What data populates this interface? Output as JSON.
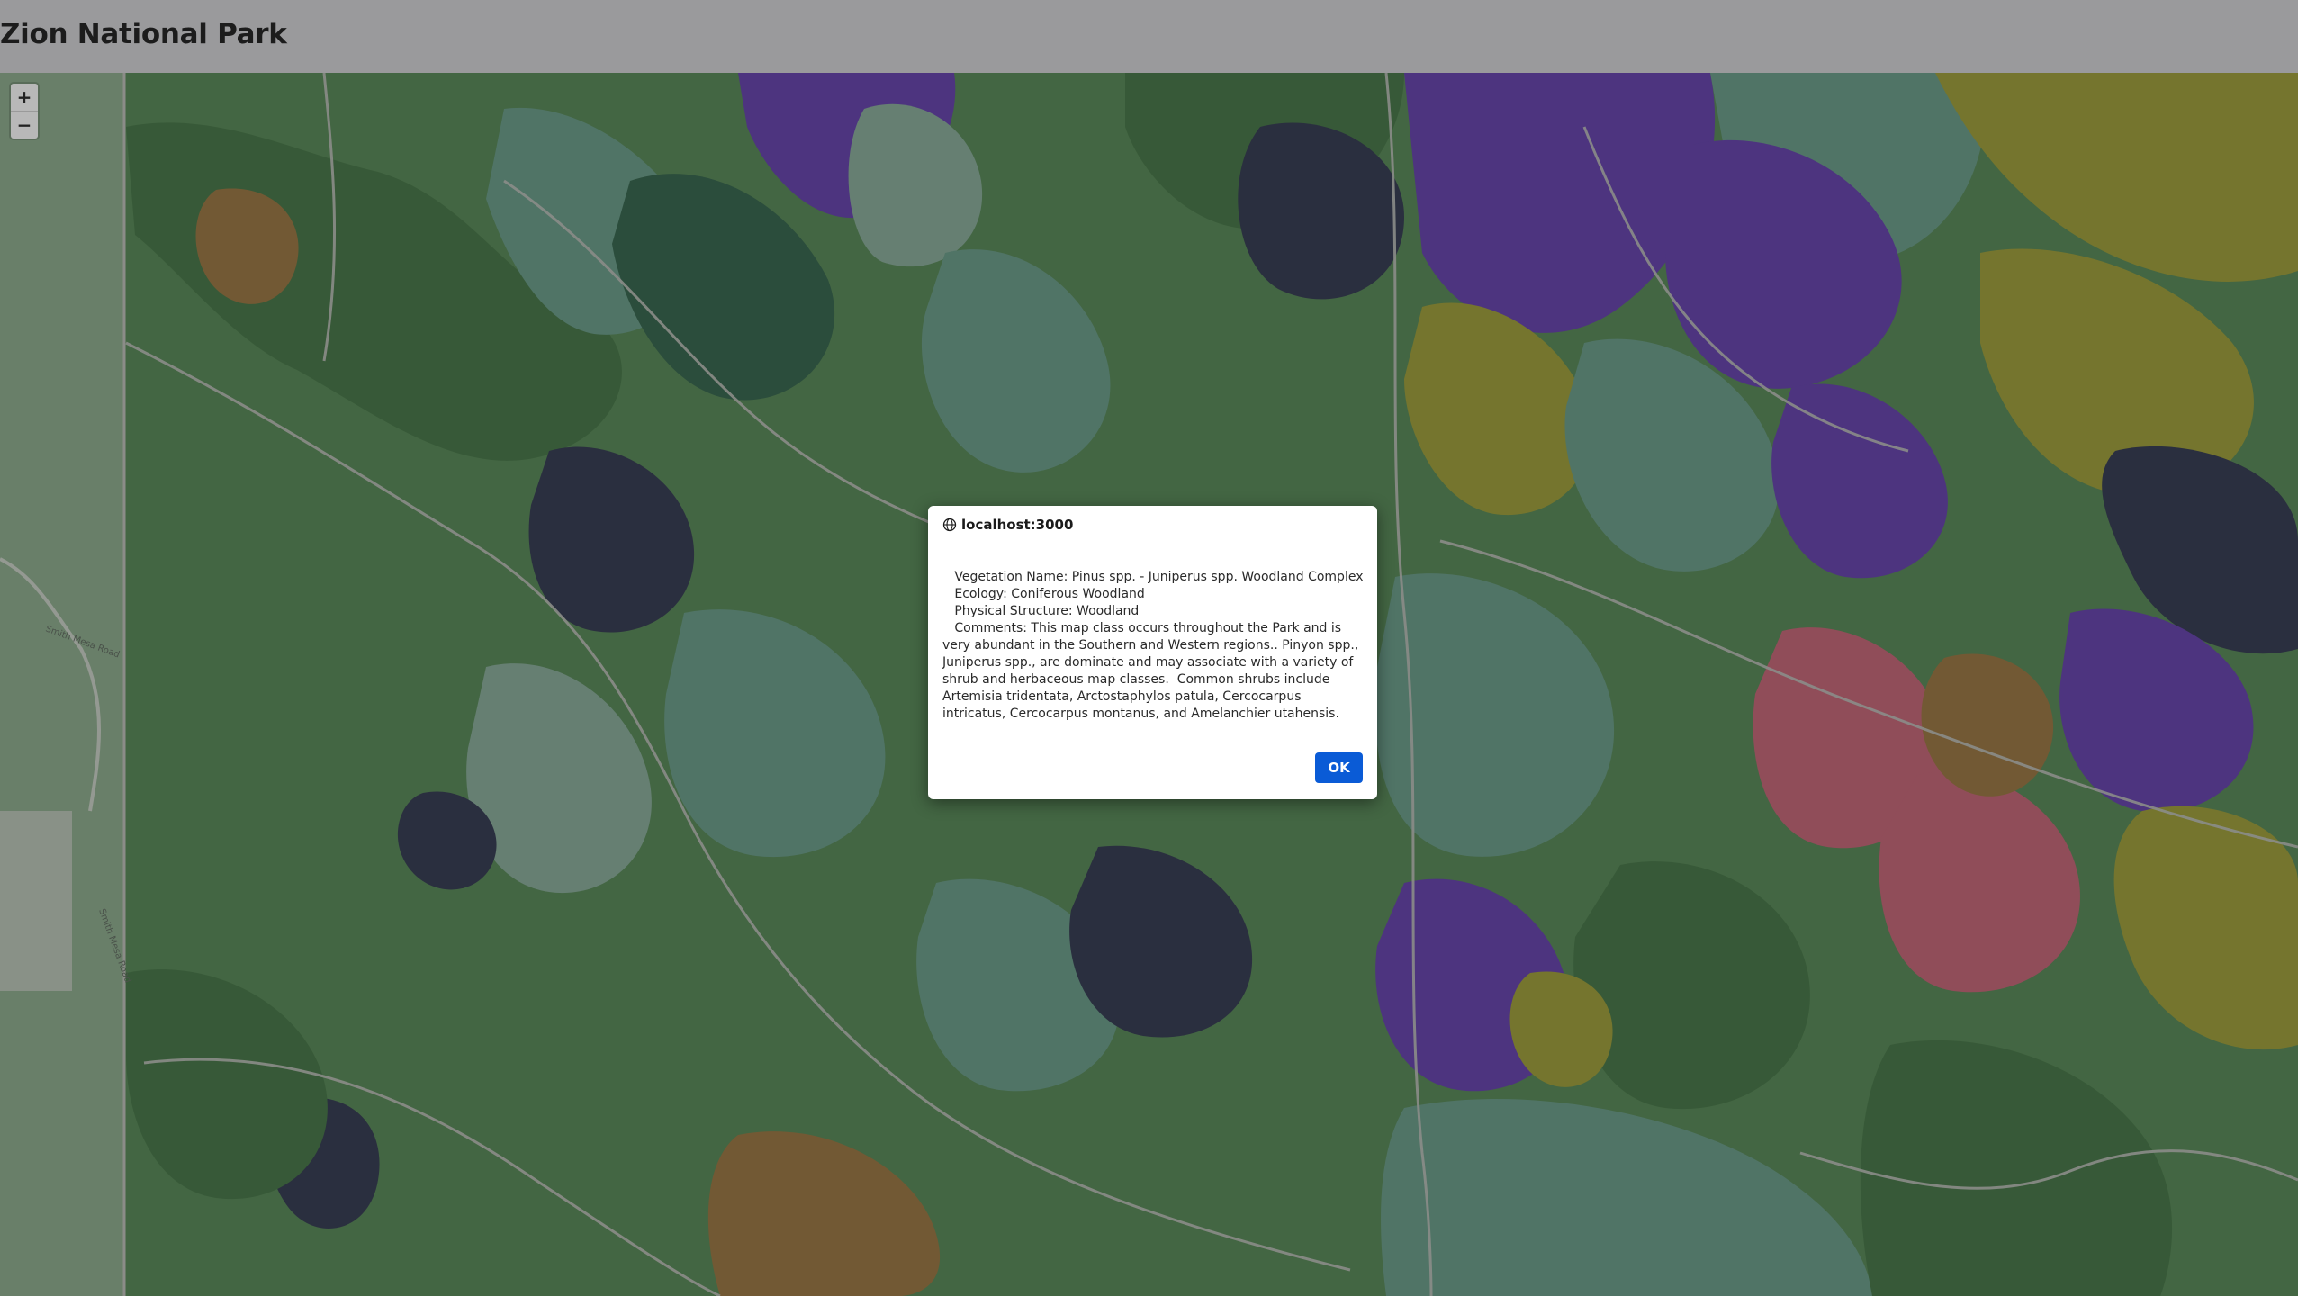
{
  "page": {
    "title": "Zion National Park"
  },
  "map": {
    "zoom_in_label": "+",
    "zoom_out_label": "−",
    "road_labels": [
      "Smith Mesa Road",
      "Smith Mesa Road"
    ],
    "colors": {
      "base_green": "#4e7a4d",
      "dark_green": "#3e6a3f",
      "teal": "#5e8c7a",
      "sage": "#7a9a8a",
      "purple": "#5a3a9a",
      "olive": "#8e8e32",
      "brown": "#8a6a3a",
      "pink": "#b05a6a",
      "navy": "#2e3448",
      "outline": "#a9aba6",
      "left_strip": "#7e9a7e"
    }
  },
  "dialog": {
    "origin": "localhost:3000",
    "message": "   Vegetation Name: Pinus spp. - Juniperus spp. Woodland Complex\n   Ecology: Coniferous Woodland\n   Physical Structure: Woodland\n   Comments: This map class occurs throughout the Park and is very abundant in the Southern and Western regions.. Pinyon spp., Juniperus spp., are dominate and may associate with a variety of shrub and herbaceous map classes.  Common shrubs include Artemisia tridentata, Arctostaphylos patula, Cercocarpus intricatus, Cercocarpus montanus, and Amelanchier utahensis.",
    "ok_label": "OK",
    "ok_color": "#0a5bd6"
  }
}
